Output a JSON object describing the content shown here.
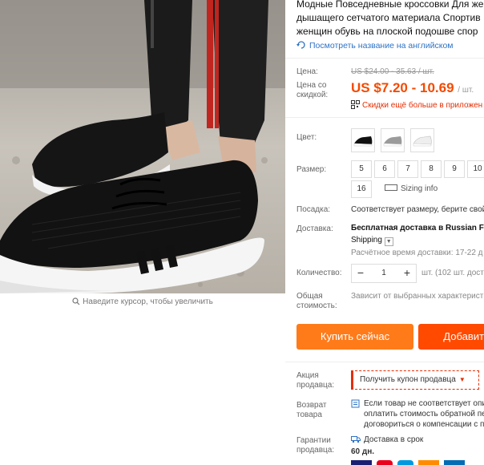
{
  "gallery": {
    "zoom_hint": "Наведите курсор, чтобы увеличить"
  },
  "product": {
    "title_lines": [
      "Модные Повседневные кроссовки Для же",
      "дышащего сетчатого материала Спортив",
      "женщин обувь на плоской подошве спор"
    ],
    "translate_link": "Посмотреть название на английском"
  },
  "price": {
    "label": "Цена:",
    "old": "US $24.00 - 35.63 / шт.",
    "discount_label": "Цена со скидкой:",
    "current": "US $7.20 - 10.69",
    "unit": "/ шт.",
    "promo": "Скидки ещё больше в приложен"
  },
  "color": {
    "label": "Цвет:",
    "swatches": [
      "black-white",
      "grey",
      "white"
    ]
  },
  "size": {
    "label": "Размер:",
    "options": [
      "5",
      "6",
      "7",
      "8",
      "9",
      "10",
      "16"
    ],
    "sizing_info": "Sizing info"
  },
  "fit": {
    "label": "Посадка:",
    "value": "Соответствует размеру, берите свой"
  },
  "delivery": {
    "label": "Доставка:",
    "line1": "Бесплатная доставка в Russian Fe",
    "line2": "Shipping",
    "estimate": "Расчётное время доставки: 17-22 д"
  },
  "quantity": {
    "label": "Количество:",
    "minus": "−",
    "value": "1",
    "plus": "+",
    "available": "шт. (102 шт. дост"
  },
  "total": {
    "label": "Общая стоимость:",
    "value": "Зависит от выбранных характерист"
  },
  "actions": {
    "buy": "Купить сейчас",
    "cart": "Добавить"
  },
  "seller_promo": {
    "label": "Акция продавца:",
    "coupon": "Получить купон продавца"
  },
  "returns": {
    "label": "Возврат товара",
    "lines": [
      "Если товар не соответствует опи",
      "оплатить стоимость обратной пе",
      "договориться о компенсации с п"
    ]
  },
  "guarantee": {
    "label": "Гарантии продавца:",
    "line1": "Доставка в срок",
    "line2": "60 дн."
  },
  "colors": {
    "accent": "#f44a00",
    "buy_button": "#ff7b1a",
    "cart_button": "#ff4a00",
    "link": "#2e73c6"
  }
}
